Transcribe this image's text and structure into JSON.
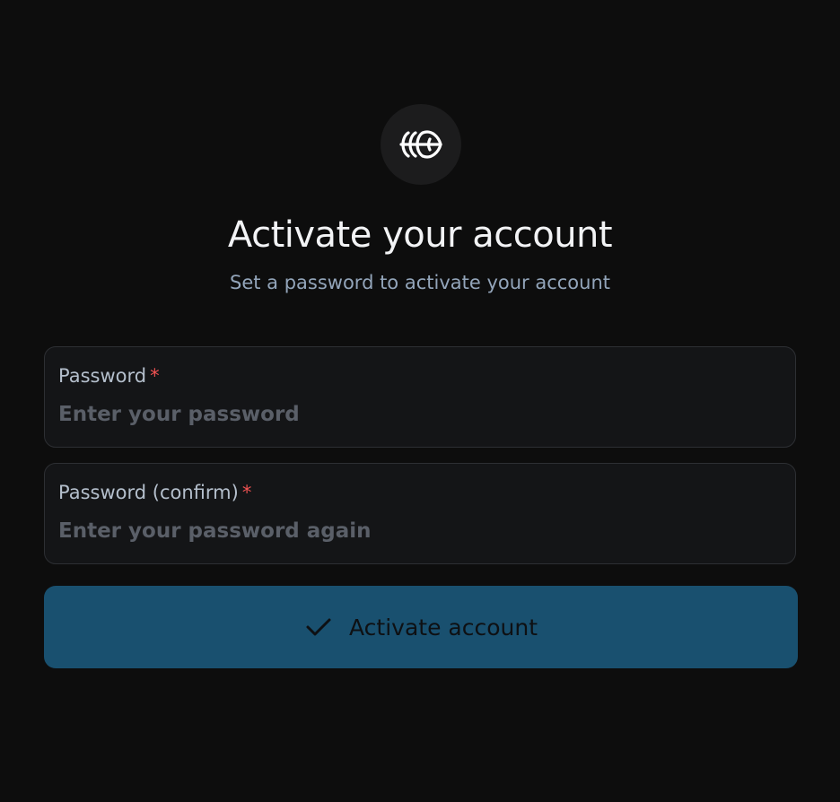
{
  "logo": {
    "icon": "brand-logo-icon"
  },
  "heading": {
    "title": "Activate your account",
    "subtitle": "Set a password to activate your account"
  },
  "form": {
    "password": {
      "label": "Password",
      "required_mark": "*",
      "placeholder": "Enter your password",
      "value": ""
    },
    "password_confirm": {
      "label": "Password (confirm)",
      "required_mark": "*",
      "placeholder": "Enter your password again",
      "value": ""
    },
    "submit": {
      "label": "Activate account",
      "icon": "check-icon"
    }
  },
  "colors": {
    "background": "#0d0d0d",
    "button": "#19506f",
    "required": "#f05252"
  }
}
